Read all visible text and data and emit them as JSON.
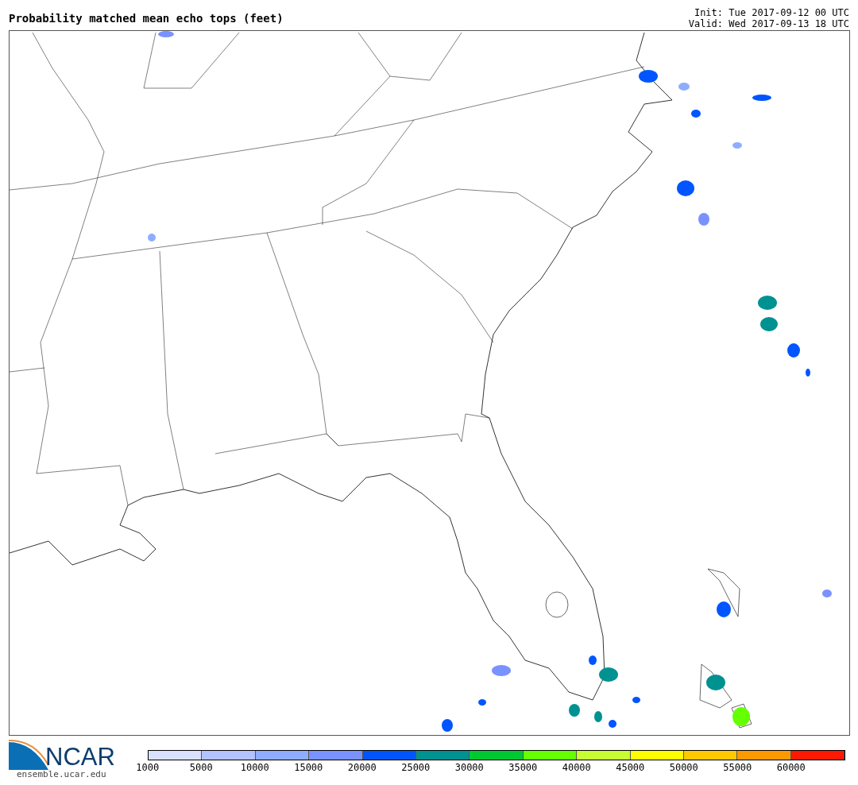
{
  "title": "Probability matched mean echo tops (feet)",
  "init": "Init: Tue 2017-09-12 00 UTC",
  "valid": "Valid: Wed 2017-09-13 18 UTC",
  "logo": {
    "text": "NCAR",
    "url": "ensemble.ucar.edu"
  },
  "legend": {
    "colors": [
      {
        "color": "#d9e1ff"
      },
      {
        "color": "#b3c3ff"
      },
      {
        "color": "#8fadff"
      },
      {
        "color": "#7a92ff"
      },
      {
        "color": "#0055ff"
      },
      {
        "color": "#009191"
      },
      {
        "color": "#00c832"
      },
      {
        "color": "#64ff00"
      },
      {
        "color": "#c8ff32"
      },
      {
        "color": "#ffff00"
      },
      {
        "color": "#ffc800"
      },
      {
        "color": "#ff9900"
      },
      {
        "color": "#ff1900"
      }
    ],
    "labels": [
      "1000",
      "5000",
      "10000",
      "15000",
      "20000",
      "25000",
      "30000",
      "35000",
      "40000",
      "45000",
      "50000",
      "55000",
      "60000"
    ]
  }
}
